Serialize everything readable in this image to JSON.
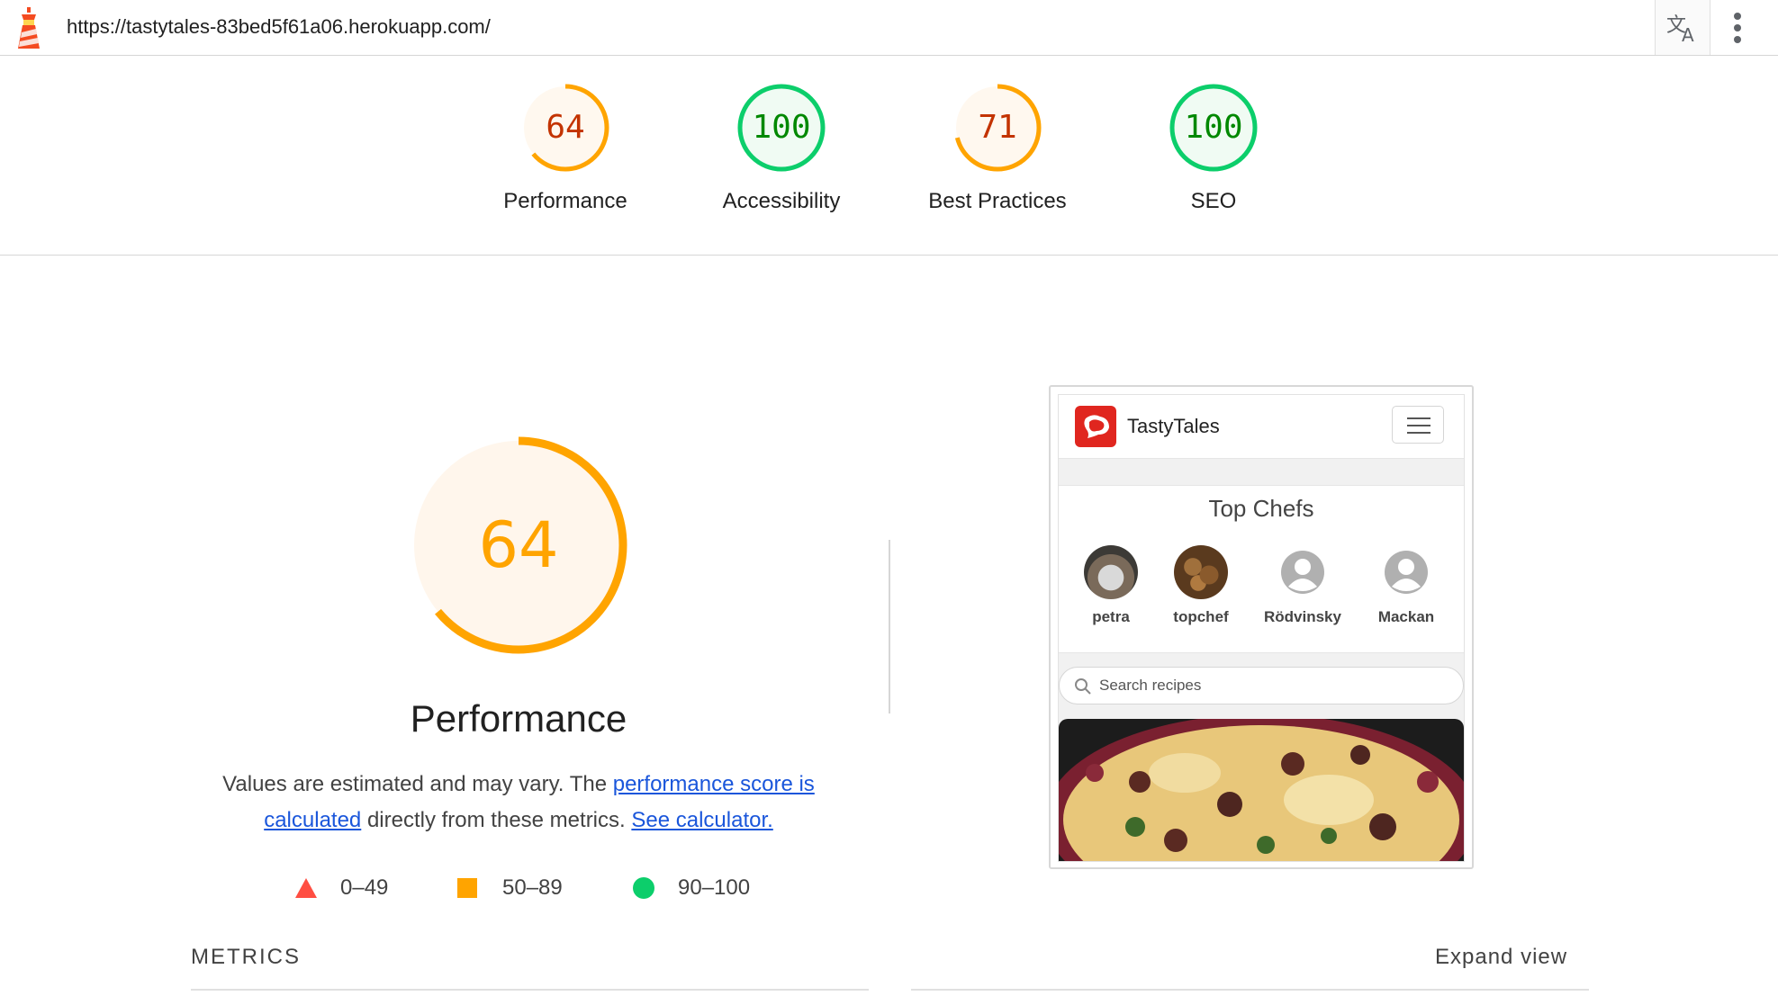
{
  "url_bar": {
    "url": "https://tastytales-83bed5f61a06.herokuapp.com/",
    "logo_icon": "lighthouse-icon",
    "translate_icon": "translate-icon",
    "menu_icon": "more-vert-icon"
  },
  "categories": [
    {
      "score": "64",
      "label": "Performance",
      "value": 64,
      "status": "average"
    },
    {
      "score": "100",
      "label": "Accessibility",
      "value": 100,
      "status": "pass"
    },
    {
      "score": "71",
      "label": "Best Practices",
      "value": 71,
      "status": "average"
    },
    {
      "score": "100",
      "label": "SEO",
      "value": 100,
      "status": "pass"
    }
  ],
  "colors": {
    "pass": "#0cce6b",
    "pass_text": "#008800",
    "average": "#ffa400",
    "average_text": "#c33300",
    "fail": "#ff4e42",
    "average_bg": "#fff8ef",
    "pass_bg": "#f0fbf3"
  },
  "performance": {
    "score": "64",
    "value": 64,
    "title": "Performance",
    "desc_prefix": "Values are estimated and may vary. The ",
    "link_score": "performance score is calculated",
    "desc_middle": " directly from these metrics. ",
    "link_calculator": "See calculator."
  },
  "legend": [
    {
      "range": "0–49",
      "shape": "triangle"
    },
    {
      "range": "50–89",
      "shape": "square"
    },
    {
      "range": "90–100",
      "shape": "circle"
    }
  ],
  "screenshot": {
    "brand": "TastyTales",
    "section_title": "Top Chefs",
    "chefs": [
      "petra",
      "topchef",
      "Rödvinsky",
      "Mackan"
    ],
    "search_placeholder": "Search recipes"
  },
  "metrics": {
    "label": "METRICS",
    "expand": "Expand view"
  }
}
